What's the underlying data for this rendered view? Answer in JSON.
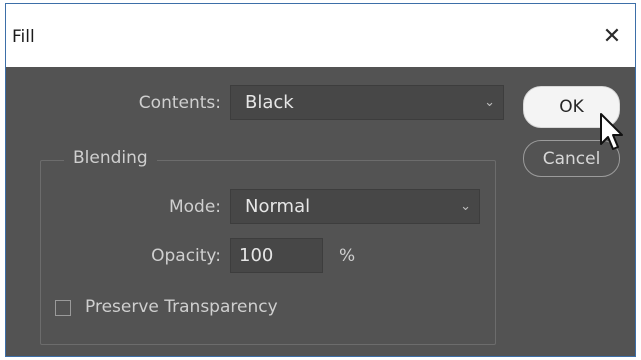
{
  "dialog": {
    "title": "Fill",
    "close_glyph": "✕",
    "contents": {
      "label": "Contents:",
      "value": "Black"
    },
    "blending": {
      "title": "Blending",
      "mode": {
        "label": "Mode:",
        "value": "Normal"
      },
      "opacity": {
        "label": "Opacity:",
        "value": "100",
        "unit": "%"
      },
      "preserve_transparency": {
        "label": "Preserve Transparency",
        "checked": false
      }
    },
    "buttons": {
      "ok": "OK",
      "cancel": "Cancel"
    }
  },
  "icons": {
    "close": "close-icon",
    "dropdown": "chevron-down-icon",
    "cursor": "pointer-cursor-icon"
  },
  "colors": {
    "dialog_bg": "#535353",
    "field_bg": "#474747",
    "label_text": "#cfcfcf",
    "ok_button_bg": "#f4f4f4"
  }
}
